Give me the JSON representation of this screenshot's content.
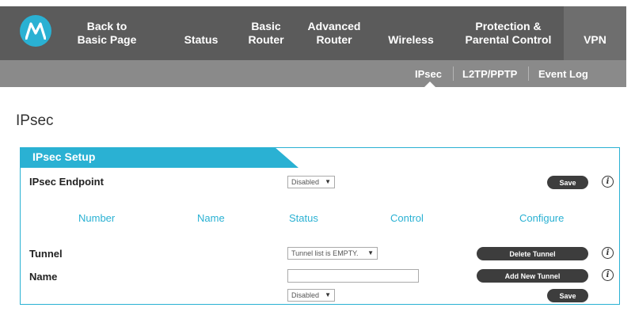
{
  "topnav": {
    "items": [
      {
        "line1": "Back to",
        "line2": "Basic Page"
      },
      {
        "line1": "",
        "line2": "Status"
      },
      {
        "line1": "Basic",
        "line2": "Router"
      },
      {
        "line1": "Advanced",
        "line2": "Router"
      },
      {
        "line1": "",
        "line2": "Wireless"
      },
      {
        "line1": "Protection &",
        "line2": "Parental Control"
      },
      {
        "line1": "",
        "line2": "VPN"
      }
    ],
    "active": "VPN",
    "colors": {
      "bar": "#5b5b5b",
      "active": "#6e6e6e",
      "logo": "#2ab1d3"
    },
    "logo_icon": "motorola-logo-icon"
  },
  "subnav": {
    "items": [
      "IPsec",
      "L2TP/PPTP",
      "Event Log"
    ],
    "active": "IPsec"
  },
  "page": {
    "title": "IPsec"
  },
  "panel": {
    "title": "IPsec Setup",
    "accent": "#2ab1d3",
    "endpoint": {
      "label": "IPsec Endpoint",
      "select_value": "Disabled",
      "save_label": "Save"
    },
    "columns": [
      "Number",
      "Name",
      "Status",
      "Control",
      "Configure"
    ],
    "tunnel": {
      "label": "Tunnel",
      "select_value": "Tunnel list is EMPTY.",
      "delete_label": "Delete Tunnel"
    },
    "name": {
      "label": "Name",
      "input_value": "",
      "add_label": "Add New Tunnel"
    },
    "bottom": {
      "select_value": "Disabled",
      "save_label": "Save"
    },
    "info_glyph": "i"
  }
}
